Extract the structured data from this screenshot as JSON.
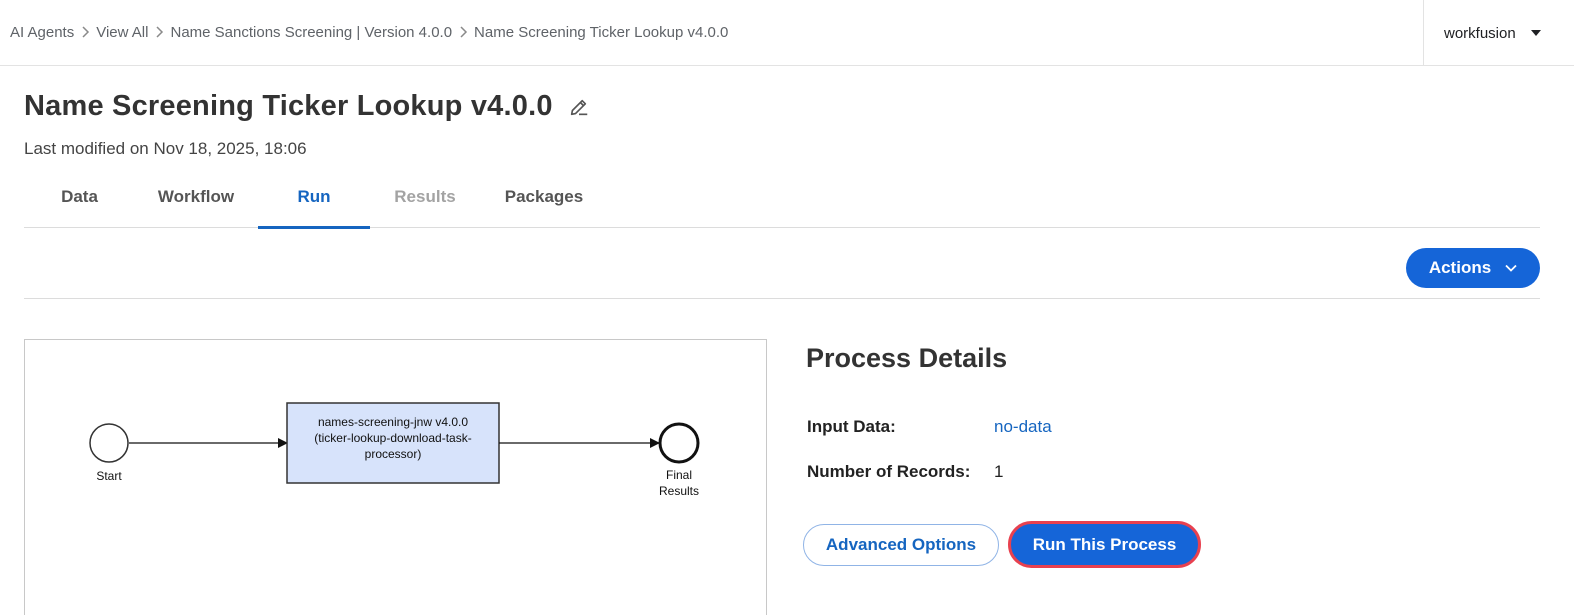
{
  "breadcrumb": {
    "items": [
      {
        "label": "AI Agents"
      },
      {
        "label": "View All"
      },
      {
        "label": "Name Sanctions Screening | Version 4.0.0"
      },
      {
        "label": "Name Screening Ticker Lookup v4.0.0"
      }
    ]
  },
  "account": {
    "name": "workfusion",
    "icon": "caret-down-icon"
  },
  "header": {
    "title": "Name Screening Ticker Lookup v4.0.0",
    "edit_icon": "pencil-icon",
    "last_modified": "Last modified on Nov 18, 2025, 18:06"
  },
  "tabs": [
    {
      "label": "Data",
      "state": "normal"
    },
    {
      "label": "Workflow",
      "state": "normal"
    },
    {
      "label": "Run",
      "state": "active"
    },
    {
      "label": "Results",
      "state": "disabled"
    },
    {
      "label": "Packages",
      "state": "normal"
    }
  ],
  "actions": {
    "label": "Actions",
    "icon": "chevron-down-icon"
  },
  "diagram": {
    "start_label": "Start",
    "task_lines": [
      "names-screening-jnw v4.0.0",
      "(ticker-lookup-download-task-",
      "processor)"
    ],
    "end_lines": [
      "Final",
      "Results"
    ]
  },
  "details": {
    "title": "Process Details",
    "input_data_label": "Input Data:",
    "input_data_value": "no-data",
    "records_label": "Number of Records:",
    "records_value": "1"
  },
  "buttons": {
    "advanced": "Advanced Options",
    "run": "Run This Process"
  },
  "colors": {
    "primary": "#1565d8",
    "link": "#1565c0",
    "run_highlight": "#e8414f",
    "task_fill": "#d7e3fb"
  }
}
